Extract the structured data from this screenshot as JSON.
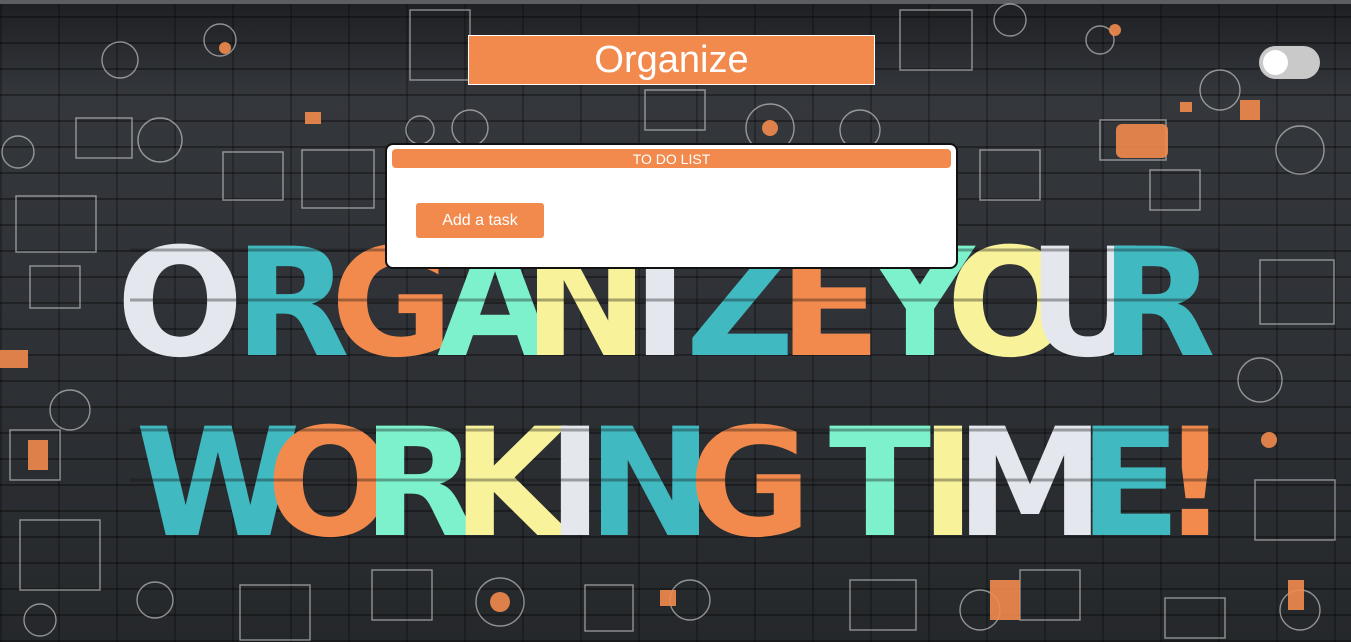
{
  "header": {
    "title": "Organize"
  },
  "theme_toggle": {
    "state": "off"
  },
  "todo": {
    "heading": "TO DO LIST",
    "add_button_label": "Add a task"
  },
  "background": {
    "line1": "ORGANIZE YOUR",
    "line2": "WORKING TIME!",
    "letter_colors": [
      "#e4e8ee",
      "#41b9c1",
      "#f28a4d",
      "#7df0cc",
      "#f8f29a"
    ]
  },
  "colors": {
    "accent": "#f28a4d",
    "card_bg": "#ffffff",
    "toggle_track": "#c9c9c9",
    "wall": "#2c2f33"
  }
}
